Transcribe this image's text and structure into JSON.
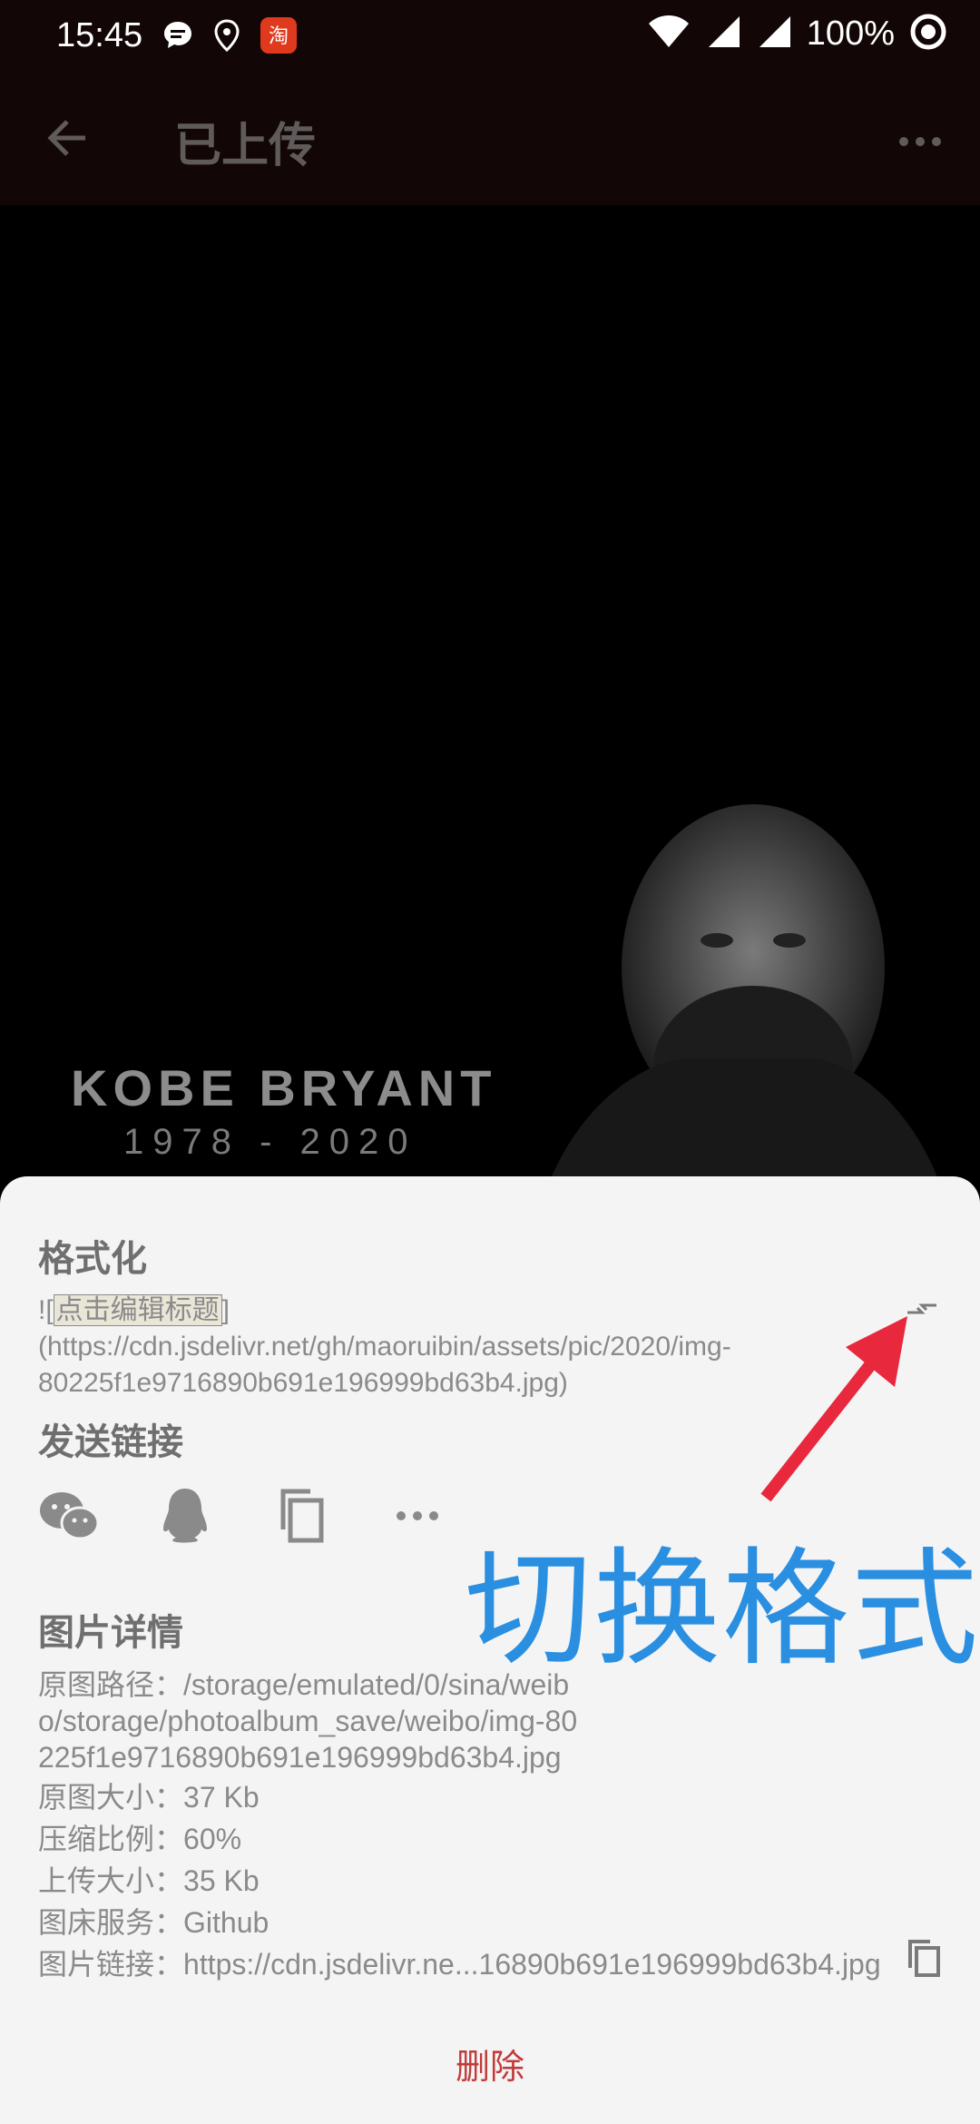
{
  "status_bar": {
    "time": "15:45",
    "battery": "100%",
    "icons": [
      "message-icon",
      "location-icon",
      "taobao-app-icon",
      "wifi-icon",
      "signal-icon",
      "signal-icon-2",
      "record-icon"
    ]
  },
  "app_bar": {
    "title": "已上传",
    "back_icon": "arrow-left-icon",
    "menu_icon": "more-horizontal-icon"
  },
  "preview": {
    "caption_name": "KOBE BRYANT",
    "caption_years": "1978 - 2020"
  },
  "sheet": {
    "format": {
      "title": "格式化",
      "prefix": "![",
      "editable_title": "点击编辑标题",
      "suffix": "](https://cdn.jsdelivr.net/gh/maoruibin/assets/pic/2020/img-80225f1e9716890b691e196999bd63b4.jpg)",
      "swap_icon": "swap-format-icon"
    },
    "share": {
      "title": "发送链接",
      "items": [
        "wechat-icon",
        "qq-icon",
        "copy-icon",
        "more-horizontal-icon"
      ]
    },
    "details": {
      "title": "图片详情",
      "original_path_label": "原图路径：",
      "original_path": "/storage/emulated/0/sina/weibo/storage/photoalbum_save/weibo/img-80225f1e9716890b691e196999bd63b4.jpg",
      "original_size_label": "原图大小：",
      "original_size": "37 Kb",
      "compression_label": "压缩比例：",
      "compression": "60%",
      "upload_size_label": "上传大小：",
      "upload_size": "35 Kb",
      "host_label": "图床服务：",
      "host": "Github",
      "link_label": "图片链接：",
      "link": "https://cdn.jsdelivr.ne...16890b691e196999bd63b4.jpg"
    },
    "delete_label": "删除"
  },
  "annotation": {
    "label": "切换格式",
    "color": "#2a8fe0",
    "arrow_color": "#e8283c"
  }
}
